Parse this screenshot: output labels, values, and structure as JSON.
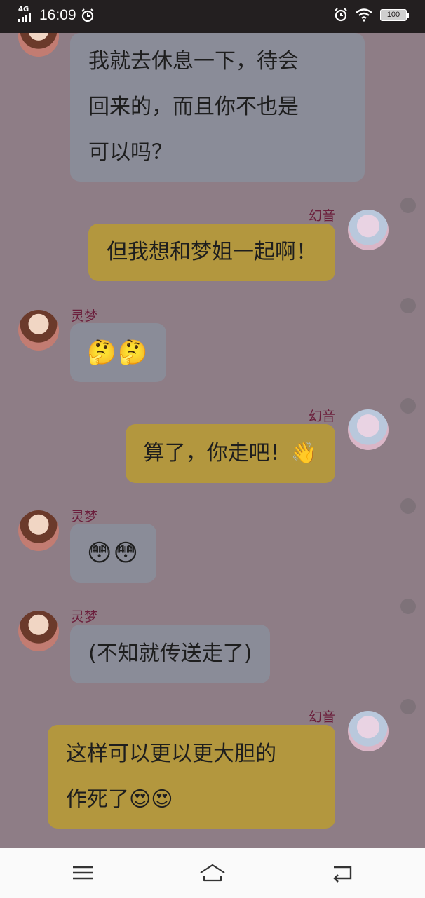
{
  "status_bar": {
    "network": "4G",
    "time": "16:09",
    "battery": "100",
    "icons": [
      "signal-icon",
      "alarm-icon",
      "wifi-icon",
      "battery-icon"
    ]
  },
  "messages": [
    {
      "side": "left",
      "sender": "",
      "lines": [
        "我就去休息一下，待会",
        "回来的，而且你不也是",
        "可以吗？"
      ]
    },
    {
      "side": "right",
      "sender": "幻音",
      "lines": [
        "但我想和梦姐一起啊！"
      ]
    },
    {
      "side": "left",
      "sender": "灵梦",
      "lines": [
        "🤔🤔"
      ]
    },
    {
      "side": "right",
      "sender": "幻音",
      "lines": [
        "算了，你走吧！👋"
      ]
    },
    {
      "side": "left",
      "sender": "灵梦",
      "lines": [
        "😳😳"
      ]
    },
    {
      "side": "left",
      "sender": "灵梦",
      "lines": [
        "(不知就传送走了)"
      ]
    },
    {
      "side": "right",
      "sender": "幻音",
      "lines": [
        "这样可以更以更大胆的",
        "作死了😍😍"
      ]
    }
  ],
  "nav_bar": {
    "icons": [
      "menu-icon",
      "home-icon",
      "back-icon"
    ]
  },
  "colors": {
    "overlay_bg": "#8e7d86",
    "left_bubble": "#8a8c98",
    "right_bubble": "#b3973e",
    "name_color": "#6b1f3c"
  }
}
